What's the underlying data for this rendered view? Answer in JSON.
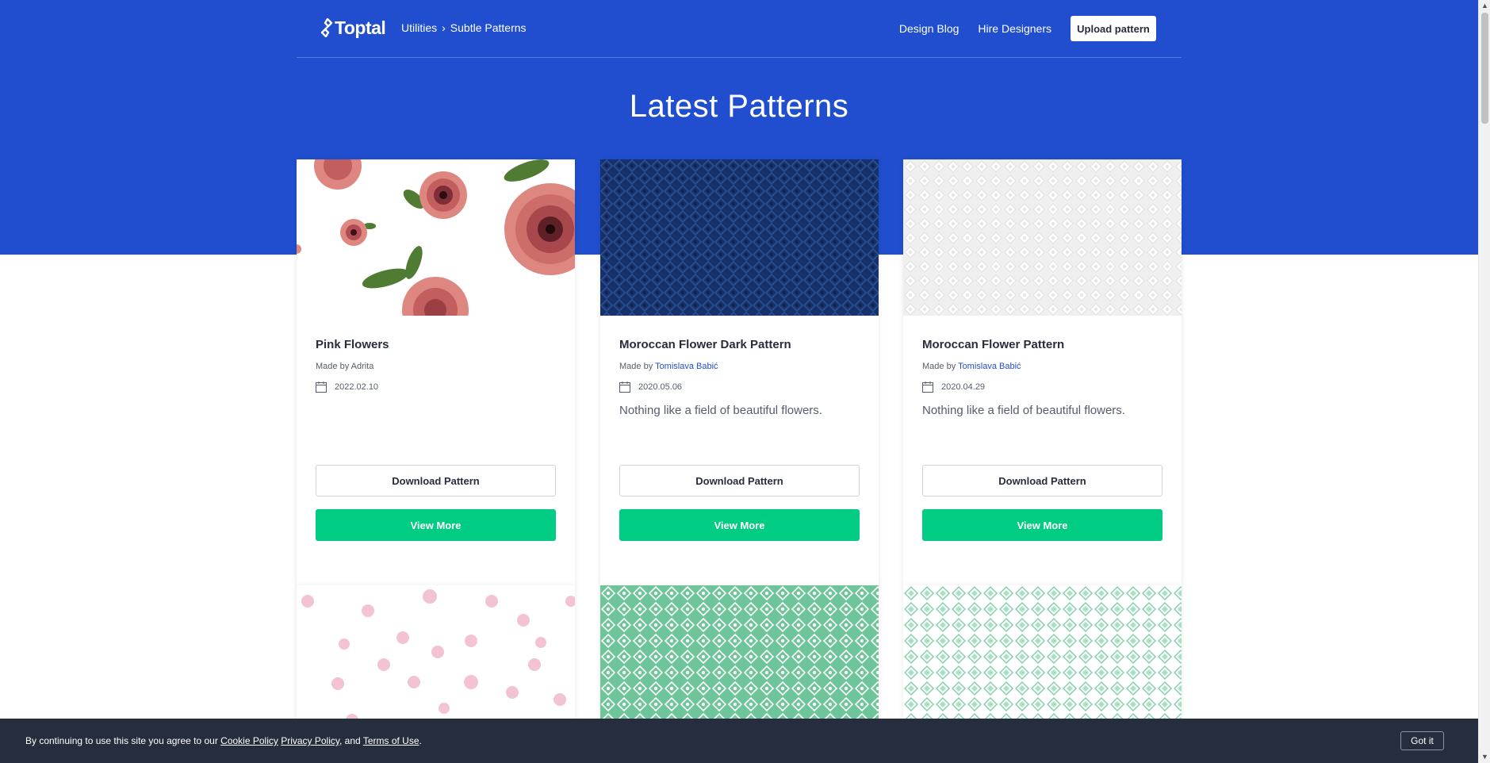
{
  "header": {
    "logo": "Toptal",
    "breadcrumb": [
      "Utilities",
      "Subtle Patterns"
    ],
    "nav": [
      "Design Blog",
      "Hire Designers"
    ],
    "upload_label": "Upload pattern"
  },
  "main": {
    "title": "Latest Patterns",
    "made_by_label": "Made by",
    "download_label": "Download Pattern",
    "view_more_label": "View More",
    "cards": [
      {
        "title": "Pink Flowers",
        "author": "Adrita",
        "author_linked": false,
        "date": "2022.02.10",
        "description": ""
      },
      {
        "title": "Moroccan Flower Dark Pattern",
        "author": "Tomislava Babić",
        "author_linked": true,
        "date": "2020.05.06",
        "description": "Nothing like a field of beautiful flowers."
      },
      {
        "title": "Moroccan Flower Pattern",
        "author": "Tomislava Babić",
        "author_linked": true,
        "date": "2020.04.29",
        "description": "Nothing like a field of beautiful flowers."
      }
    ]
  },
  "cookie": {
    "prefix": "By continuing to use this site you agree to our",
    "cookie_policy": "Cookie Policy",
    "privacy_policy": "Privacy Policy",
    "and": ", and",
    "terms": "Terms of Use",
    "suffix": ".",
    "button": "Got it"
  },
  "colors": {
    "brand_blue": "#204ecf",
    "green": "#00cc83",
    "dark": "#262d3d"
  }
}
